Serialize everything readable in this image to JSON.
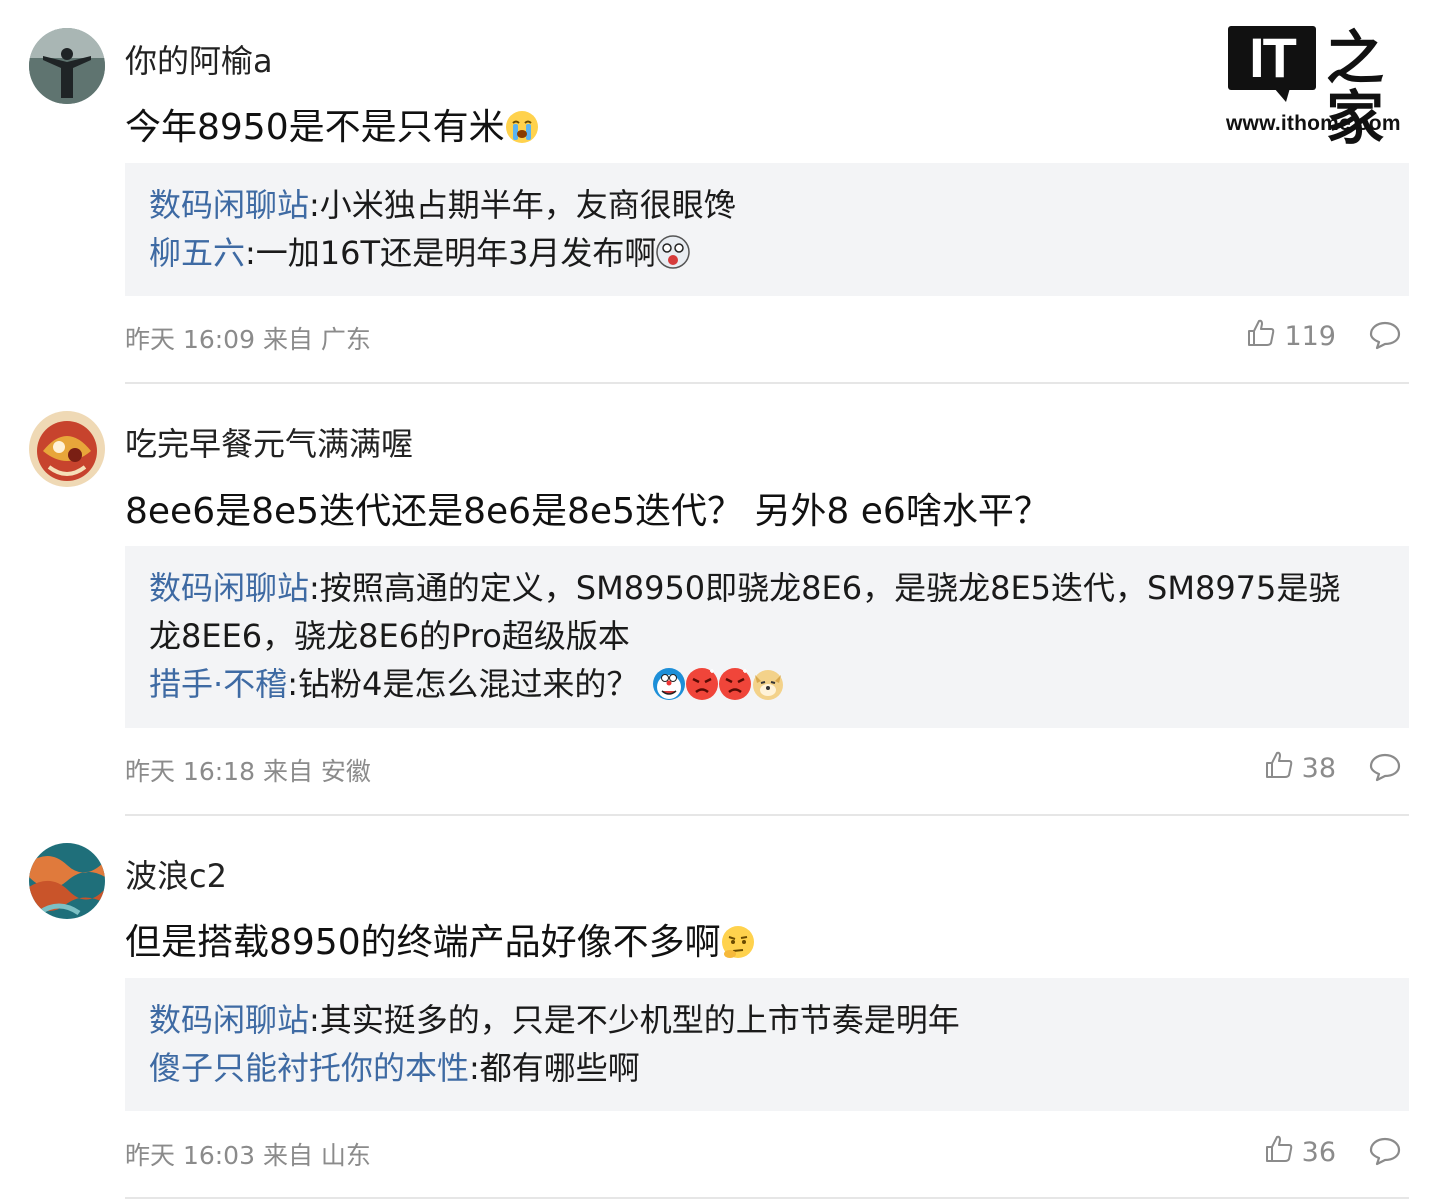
{
  "watermark": {
    "logo_letters": "IT之家",
    "url": "www.ithome.com"
  },
  "comments": [
    {
      "username": "你的阿榆a",
      "content": "今年8950是不是只有米",
      "content_emoji": "crying-emoji",
      "replies": [
        {
          "name": "数码闲聊站",
          "sep": ":",
          "text": "小米独占期半年，友商很眼馋"
        },
        {
          "name": "柳五六",
          "sep": ":",
          "text": "一加16T还是明年3月发布啊",
          "emoji": "shocked-emoji"
        }
      ],
      "time": "昨天 16:09",
      "source_label": "来自",
      "location": "广东",
      "likes": "119"
    },
    {
      "username": "吃完早餐元气满满喔",
      "content": "8ee6是8e5迭代还是8e6是8e5迭代？ 另外8 e6啥水平？",
      "replies": [
        {
          "name": "数码闲聊站",
          "sep": ":",
          "text": "按照高通的定义，SM8950即骁龙8E6，是骁龙8E5迭代，SM8975是骁",
          "text2": "龙8EE6，骁龙8E6的Pro超级版本"
        },
        {
          "name": "措手·不稽",
          "sep": ":",
          "text": "钻粉4是怎么混过来的？",
          "emojis": [
            "doraemon-emoji",
            "angry-emoji",
            "angry-emoji",
            "doge-emoji"
          ]
        }
      ],
      "time": "昨天 16:18",
      "source_label": "来自",
      "location": "安徽",
      "likes": "38"
    },
    {
      "username": "波浪c2",
      "content": "但是搭载8950的终端产品好像不多啊",
      "content_emoji": "thinking-emoji",
      "replies": [
        {
          "name": "数码闲聊站",
          "sep": ":",
          "text": "其实挺多的，只是不少机型的上市节奏是明年"
        },
        {
          "name": "傻子只能衬托你的本性",
          "sep": ":",
          "text": "都有哪些啊"
        }
      ],
      "time": "昨天 16:03",
      "source_label": "来自",
      "location": "山东",
      "likes": "36"
    }
  ],
  "colors": {
    "reply_name": "#3e6aa3",
    "reply_bg": "#f3f4f6",
    "meta": "#8b8b8b"
  }
}
